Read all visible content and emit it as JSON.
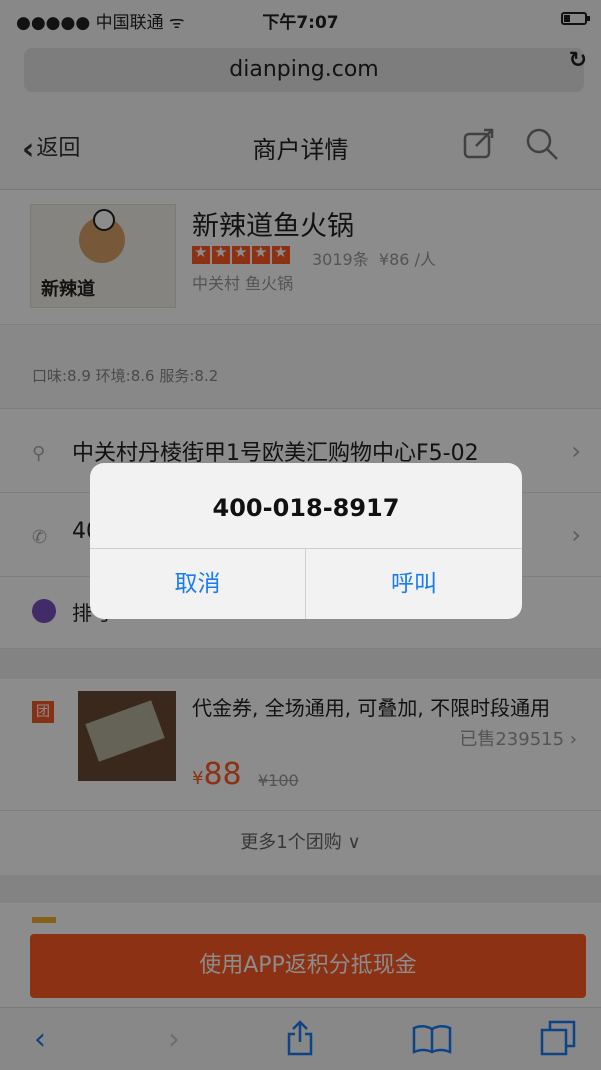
{
  "status": {
    "carrier": "●●●●● 中国联通 ᯤ",
    "time": "下午7:07"
  },
  "browser": {
    "url": "dianping.com",
    "reload_icon": "reload-icon"
  },
  "nav": {
    "back": "返回",
    "title": "商户详情",
    "icons": [
      "share-icon",
      "search-icon"
    ]
  },
  "merchant": {
    "logo_text": "新辣道",
    "name": "新辣道鱼火锅",
    "reviews": "3019条",
    "avg_price": "¥86 /人",
    "area": "中关村 鱼火锅",
    "rating": 4.5
  },
  "scores": "口味:8.9 环境:8.6 服务:8.2",
  "address": "中关村丹棱街甲1号欧美汇购物中心F5-02",
  "phone_partial": "40",
  "queue_partial": "排号",
  "deal": {
    "badge": "团",
    "desc": "代金券, 全场通用, 可叠加, 不限时段通用",
    "sold": "已售239515",
    "currency": "¥",
    "price": "88",
    "original": "¥100"
  },
  "more": "更多1个团购 ∨",
  "app_button": "使用APP返积分抵现金",
  "dialog": {
    "number": "400-018-8917",
    "cancel": "取消",
    "call": "呼叫"
  },
  "colors": {
    "accent": "#ff5a23",
    "link": "#1a7cf4",
    "queue": "#7a4fc2"
  }
}
